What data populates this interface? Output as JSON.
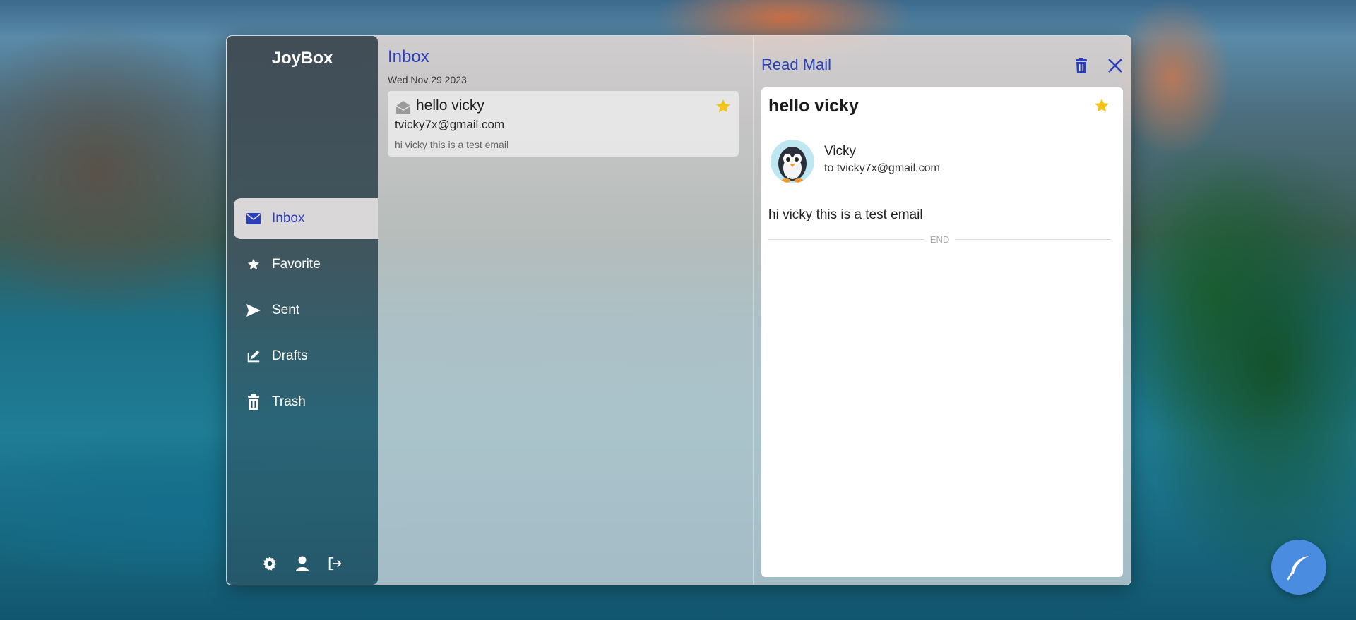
{
  "app": {
    "brand": "JoyBox"
  },
  "sidebar": {
    "items": [
      {
        "label": "Inbox",
        "icon": "envelope-icon",
        "active": true
      },
      {
        "label": "Favorite",
        "icon": "star-icon",
        "active": false
      },
      {
        "label": "Sent",
        "icon": "send-icon",
        "active": false
      },
      {
        "label": "Drafts",
        "icon": "pen-icon",
        "active": false
      },
      {
        "label": "Trash",
        "icon": "trash-icon",
        "active": false
      }
    ],
    "footer": [
      "gear-icon",
      "user-icon",
      "logout-icon"
    ]
  },
  "list": {
    "title": "Inbox",
    "date": "Wed Nov 29 2023",
    "emails": [
      {
        "subject": "hello vicky",
        "from": "tvicky7x@gmail.com",
        "preview": "hi vicky this is a test email",
        "starred": true,
        "icon": "envelope-open-icon"
      }
    ]
  },
  "reader": {
    "title": "Read Mail",
    "subject": "hello vicky",
    "starred": true,
    "sender": "Vicky",
    "to": "to tvicky7x@gmail.com",
    "message": "hi vicky this is a test email",
    "end_label": "END"
  },
  "colors": {
    "accent": "#2a3fb8",
    "star": "#f2c418",
    "fab": "#4a8ce0"
  }
}
